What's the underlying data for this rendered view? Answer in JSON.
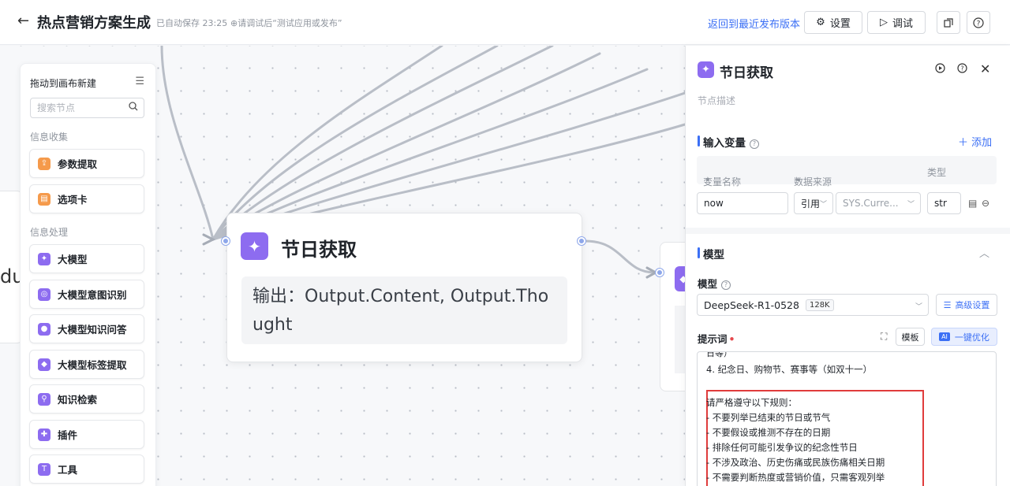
{
  "header": {
    "back_icon": "←",
    "title": "热点营销方案生成",
    "autosave": "已自动保存 23:25",
    "hint": "⊕请调试后“测试应用或发布”",
    "revert": "返回到最近发布版本",
    "settings_label": "设置",
    "debug_label": "调试"
  },
  "palette": {
    "title": "拖动到画布新建",
    "search_placeholder": "搜索节点",
    "sections": [
      {
        "label": "信息收集",
        "items": [
          {
            "label": "参数提取",
            "icon": "extract-icon",
            "color": "#f59a4b"
          },
          {
            "label": "选项卡",
            "icon": "card-icon",
            "color": "#f59a4b"
          }
        ]
      },
      {
        "label": "信息处理",
        "items": [
          {
            "label": "大模型",
            "icon": "sparkle-icon",
            "color": "#8d6cf0"
          },
          {
            "label": "大模型意图识别",
            "icon": "intent-icon",
            "color": "#8d6cf0"
          },
          {
            "label": "大模型知识问答",
            "icon": "qa-icon",
            "color": "#8d6cf0"
          },
          {
            "label": "大模型标签提取",
            "icon": "tag-icon",
            "color": "#8d6cf0"
          },
          {
            "label": "知识检索",
            "icon": "search-icon",
            "color": "#8d6cf0"
          },
          {
            "label": "插件",
            "icon": "plugin-icon",
            "color": "#8d6cf0"
          },
          {
            "label": "工具",
            "icon": "tool-icon",
            "color": "#8d6cf0"
          }
        ]
      }
    ]
  },
  "canvas": {
    "left_stub_text": "du",
    "node": {
      "title": "节日获取",
      "output": "输出：Output.Content, Output.Thought"
    }
  },
  "panel": {
    "title": "节日获取",
    "description_placeholder": "节点描述",
    "inputs": {
      "title": "输入变量",
      "add_label": "添加",
      "columns": [
        "变量名称",
        "数据来源",
        "类型"
      ],
      "row": {
        "name": "now",
        "source_type": "引用",
        "source_value": "SYS.Curre...",
        "type": "str"
      }
    },
    "model": {
      "section_title": "模型",
      "label": "模型",
      "value": "DeepSeek-R1-0528",
      "badge": "128K",
      "advanced_label": "高级设置"
    },
    "prompt": {
      "label": "提示词",
      "template_label": "模板",
      "ai_tag": "AI",
      "optimize_label": "一键优化",
      "cut_line": "日等）",
      "line_item4": "4. 纪念日、购物节、赛事等（如双十一）",
      "rules": [
        "请严格遵守以下规则：",
        "- 不要列举已结束的节日或节气",
        "- 不要假设或推测不存在的日期",
        "- 排除任何可能引发争议的纪念性节日",
        "- 不涉及政治、历史伤痛或民族伤痛相关日期",
        "- 不需要判断热度或营销价值，只需客观列举"
      ]
    }
  },
  "colors": {
    "accent": "#3b6ff5",
    "node_purple": "#8d6cf0",
    "node_orange": "#f59a4b",
    "highlight": "#e03c3c"
  }
}
